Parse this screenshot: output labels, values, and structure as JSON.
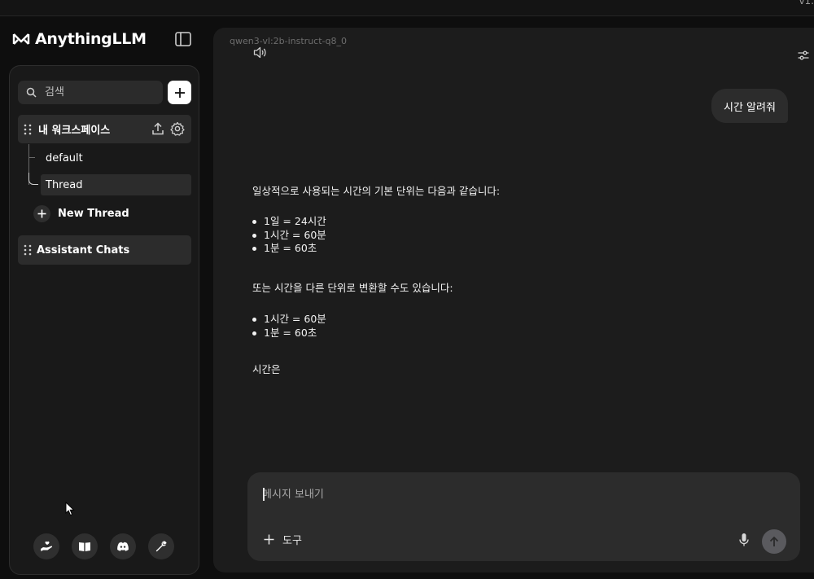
{
  "app": {
    "name": "AnythingLLM",
    "version_fragment": "v1."
  },
  "sidebar": {
    "search_placeholder": "검색",
    "workspace": {
      "name": "내 워크스페이스",
      "threads": [
        {
          "label": "default",
          "active": false
        },
        {
          "label": "Thread",
          "active": true
        }
      ],
      "new_thread_label": "New Thread"
    },
    "assistant_chats_label": "Assistant Chats"
  },
  "chat": {
    "model": "qwen3-vl:2b-instruct-q8_0",
    "user_message": "시간 알려줘",
    "response": {
      "intro": "일상적으로 사용되는 시간의 기본 단위는 다음과 같습니다:",
      "list1": [
        "1일 = 24시간",
        "1시간 = 60분",
        "1분 = 60초"
      ],
      "middle": "또는 시간을 다른 단위로 변환할 수도 있습니다:",
      "list2": [
        "1시간 = 60분",
        "1분 = 60초"
      ],
      "tail": "시간은"
    }
  },
  "composer": {
    "placeholder": "메시지 보내기",
    "tools_label": "도구"
  },
  "icons": {
    "accent": "#ffffff",
    "send_button_color": "#5a5a5e"
  }
}
